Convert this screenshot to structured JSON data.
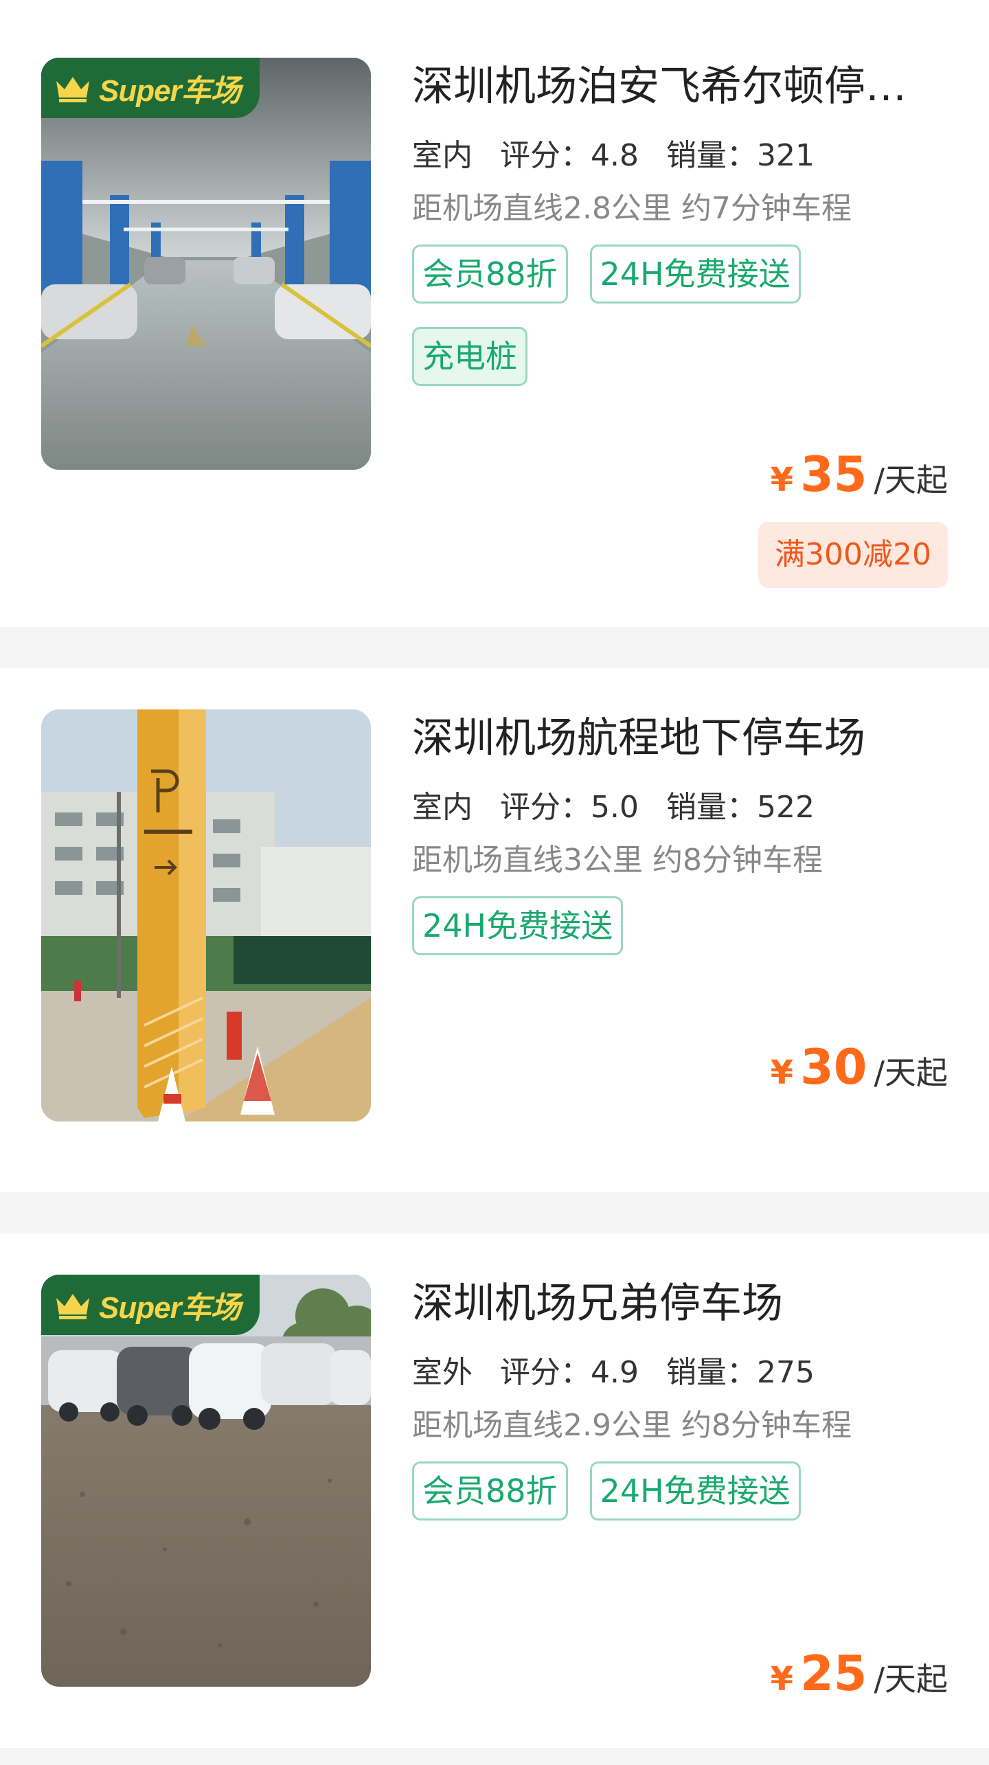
{
  "listings": [
    {
      "super_badge": "Super车场",
      "title": "深圳机场泊安飞希尔顿停…",
      "type": "室内",
      "rating": "评分：4.8",
      "sales": "销量：321",
      "distance": "距机场直线2.8公里 约7分钟车程",
      "tags": [
        "会员88折",
        "24H免费接送",
        "充电桩"
      ],
      "currency": "¥",
      "price": "35",
      "price_unit": "/天起",
      "discount": "满300减20"
    },
    {
      "title": "深圳机场航程地下停车场",
      "type": "室内",
      "rating": "评分：5.0",
      "sales": "销量：522",
      "distance": "距机场直线3公里 约8分钟车程",
      "tags": [
        "24H免费接送"
      ],
      "currency": "¥",
      "price": "30",
      "price_unit": "/天起"
    },
    {
      "super_badge": "Super车场",
      "title": "深圳机场兄弟停车场",
      "type": "室外",
      "rating": "评分：4.9",
      "sales": "销量：275",
      "distance": "距机场直线2.9公里 约8分钟车程",
      "tags": [
        "会员88折",
        "24H免费接送"
      ],
      "currency": "¥",
      "price": "25",
      "price_unit": "/天起"
    }
  ],
  "colors": {
    "accent_green": "#19a871",
    "price_orange": "#ff6a1a",
    "badge_green": "#1e6b37",
    "badge_gold": "#f7d54a"
  },
  "icons": {
    "crown": "crown-icon"
  }
}
